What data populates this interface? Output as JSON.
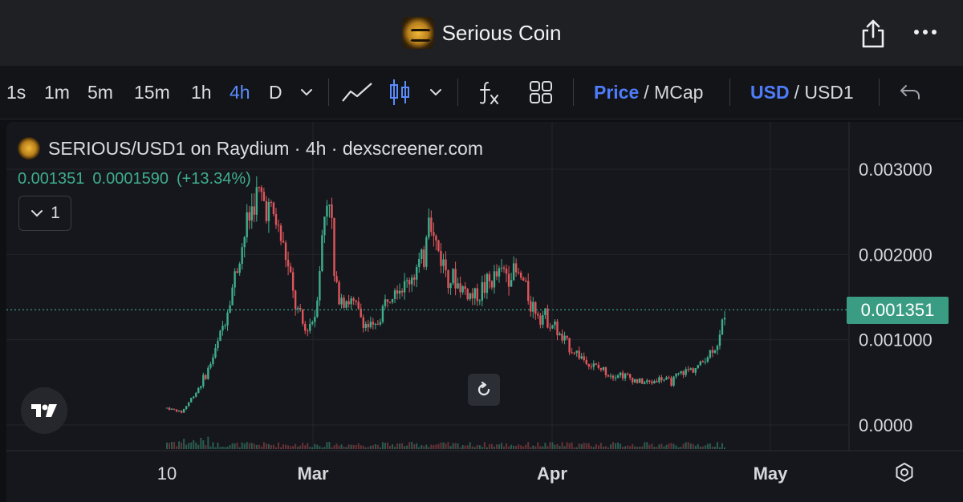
{
  "app": {
    "title": "Serious Coin"
  },
  "icons": {
    "logo": "coin-logo-icon",
    "share": "share-icon",
    "more": "more-icon",
    "line_chart": "line-chart-icon",
    "candles": "candlestick-icon",
    "indicators": "function-icon",
    "layouts": "grid-icon",
    "undo": "undo-icon",
    "tradingview": "tradingview-logo-icon",
    "reset": "reset-icon",
    "settings": "settings-icon"
  },
  "toolbar": {
    "intervals": [
      "1s",
      "1m",
      "5m",
      "15m",
      "1h",
      "4h",
      "D"
    ],
    "active_interval": "4h",
    "price_label": "Price",
    "mcap_label": "/ MCap",
    "usd_label": "USD",
    "usd1_label": "/ USD1"
  },
  "legend": {
    "pair": "SERIOUS/USD1 on Raydium · 4h · dexscreener.com",
    "close": "0.001351",
    "change": "0.0001590",
    "change_pct": "(+13.34%)",
    "series_count": "1"
  },
  "colors": {
    "up": "#3fae8c",
    "down": "#e0555c",
    "accent": "#4f7dfa",
    "last_price": "#3a9d83"
  },
  "chart_data": {
    "type": "candlestick",
    "x_tick_labels": [
      "10",
      "Mar",
      "Apr",
      "May"
    ],
    "y_tick_labels": [
      "0.0000",
      "0.001000",
      "0.002000",
      "0.003000"
    ],
    "ylim": [
      0,
      0.0032
    ],
    "last_price": 0.001351,
    "last_price_label": "0.001351",
    "price_path": [
      [
        0,
        0.0002
      ],
      [
        3,
        0.00015
      ],
      [
        6,
        0.0004
      ],
      [
        8,
        0.0006
      ],
      [
        10,
        0.0009
      ],
      [
        12,
        0.0013
      ],
      [
        14,
        0.0018
      ],
      [
        16,
        0.0023
      ],
      [
        18,
        0.0027
      ],
      [
        20,
        0.0026
      ],
      [
        22,
        0.0024
      ],
      [
        24,
        0.002
      ],
      [
        26,
        0.0014
      ],
      [
        28,
        0.0011
      ],
      [
        30,
        0.0013
      ],
      [
        32,
        0.0025
      ],
      [
        33,
        0.0028
      ],
      [
        34,
        0.0016
      ],
      [
        36,
        0.0015
      ],
      [
        38,
        0.0014
      ],
      [
        40,
        0.0012
      ],
      [
        42,
        0.0011
      ],
      [
        44,
        0.0014
      ],
      [
        46,
        0.0017
      ],
      [
        48,
        0.0016
      ],
      [
        50,
        0.0018
      ],
      [
        52,
        0.0019
      ],
      [
        53,
        0.0026
      ],
      [
        54,
        0.0022
      ],
      [
        56,
        0.0019
      ],
      [
        58,
        0.0017
      ],
      [
        60,
        0.0016
      ],
      [
        62,
        0.0015
      ],
      [
        64,
        0.0016
      ],
      [
        66,
        0.0017
      ],
      [
        68,
        0.0018
      ],
      [
        70,
        0.0018
      ],
      [
        72,
        0.0017
      ],
      [
        74,
        0.0014
      ],
      [
        76,
        0.0013
      ],
      [
        78,
        0.0012
      ],
      [
        80,
        0.001
      ],
      [
        82,
        0.0009
      ],
      [
        84,
        0.0008
      ],
      [
        86,
        0.0007
      ],
      [
        88,
        0.00065
      ],
      [
        90,
        0.0006
      ],
      [
        92,
        0.0006
      ],
      [
        94,
        0.00055
      ],
      [
        96,
        0.0005
      ],
      [
        98,
        0.0005
      ],
      [
        100,
        0.00055
      ],
      [
        102,
        0.0005
      ],
      [
        104,
        0.0006
      ],
      [
        106,
        0.00065
      ],
      [
        108,
        0.0007
      ],
      [
        110,
        0.00085
      ],
      [
        112,
        0.001
      ],
      [
        113,
        0.001351
      ]
    ],
    "grid": true
  }
}
